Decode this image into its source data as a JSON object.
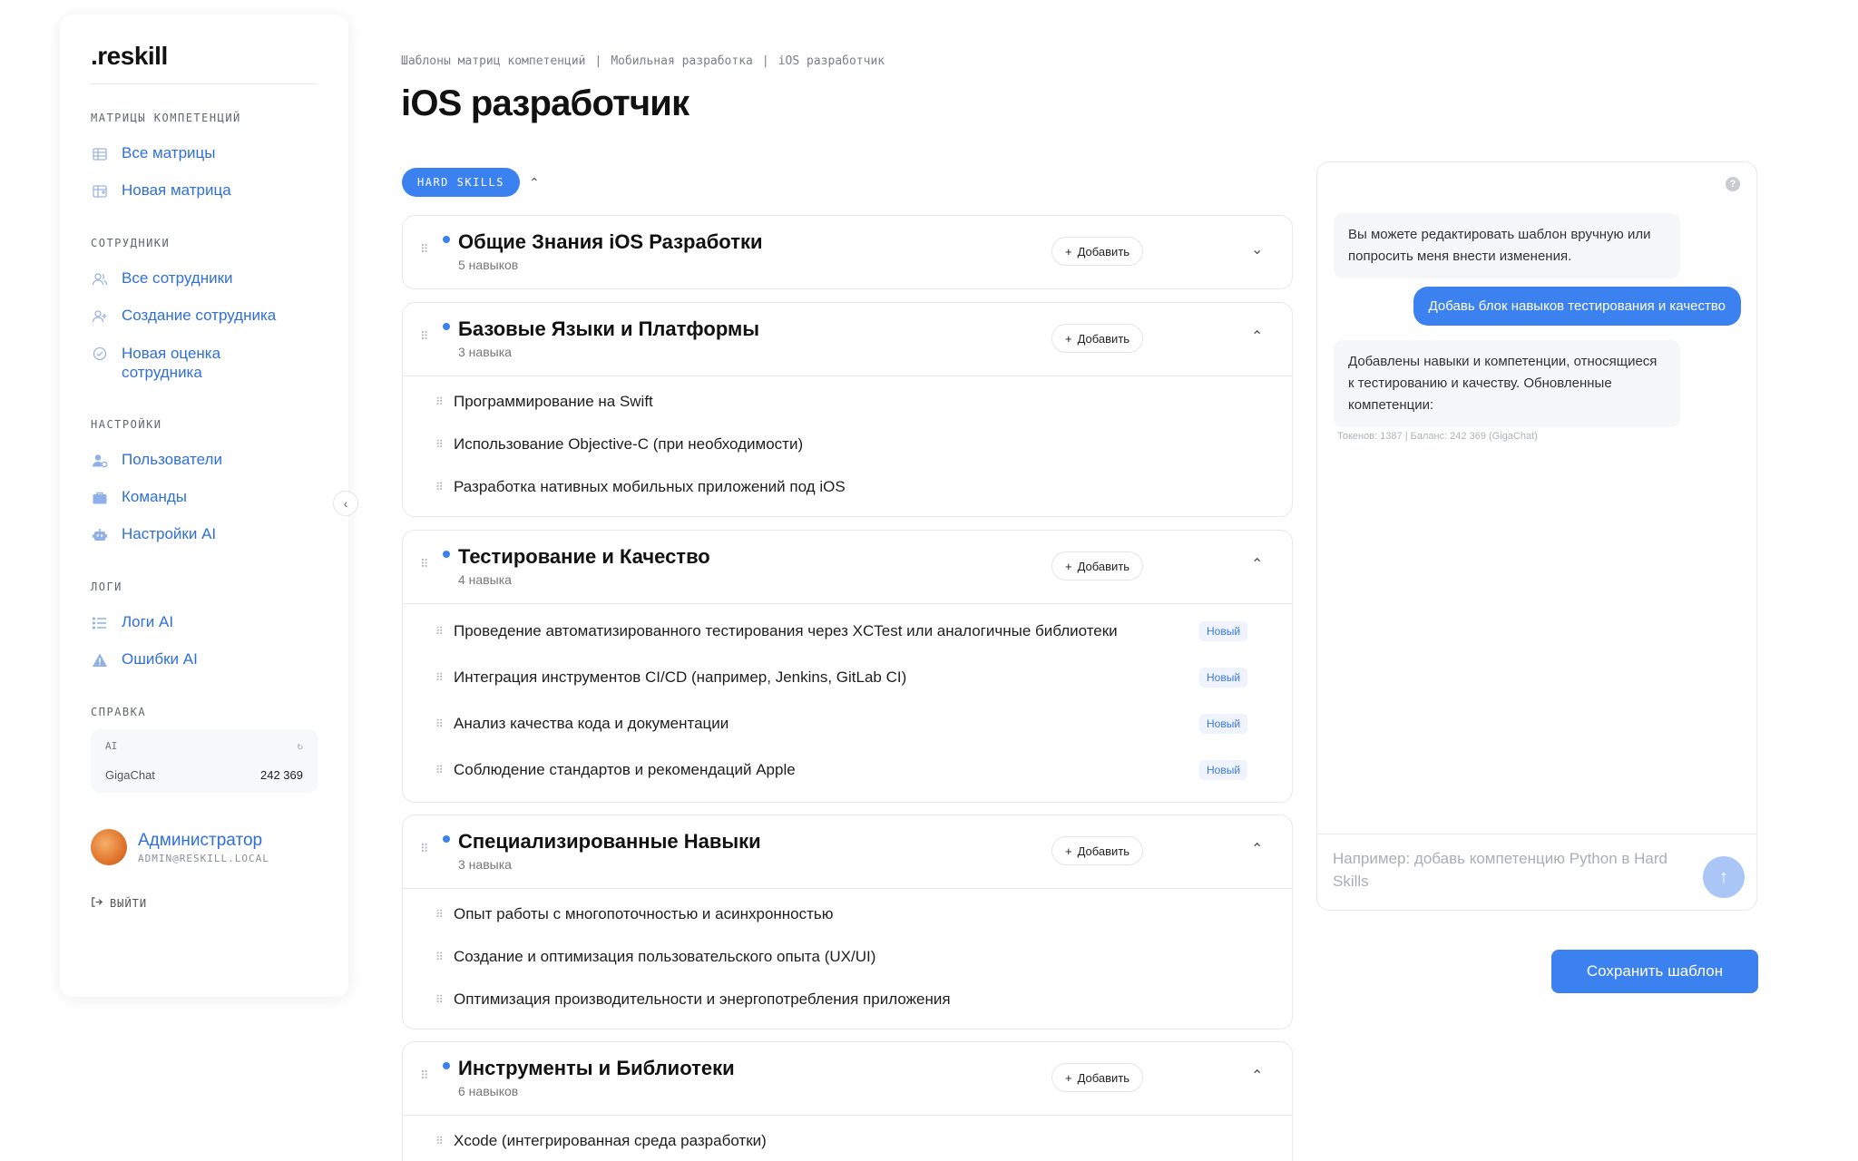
{
  "app": {
    "logo": ".reskill"
  },
  "sidebar": {
    "sections": [
      {
        "title": "МАТРИЦЫ КОМПЕТЕНЦИЙ",
        "items": [
          {
            "label": "Все матрицы",
            "icon": "table-icon"
          },
          {
            "label": "Новая матрица",
            "icon": "table-plus-icon"
          }
        ]
      },
      {
        "title": "СОТРУДНИКИ",
        "items": [
          {
            "label": "Все сотрудники",
            "icon": "users-icon"
          },
          {
            "label": "Создание сотрудника",
            "icon": "user-plus-icon"
          },
          {
            "label": "Новая оценка сотрудника",
            "icon": "badge-check-icon"
          }
        ]
      },
      {
        "title": "НАСТРОЙКИ",
        "items": [
          {
            "label": "Пользователи",
            "icon": "user-gear-icon"
          },
          {
            "label": "Команды",
            "icon": "briefcase-icon"
          },
          {
            "label": "Настройки AI",
            "icon": "robot-icon"
          }
        ]
      },
      {
        "title": "ЛОГИ",
        "items": [
          {
            "label": "Логи AI",
            "icon": "list-icon"
          },
          {
            "label": "Ошибки AI",
            "icon": "warning-icon"
          }
        ]
      }
    ],
    "help": {
      "title": "СПРАВКА",
      "ai_label": "AI",
      "provider": "GigaChat",
      "balance": "242 369"
    },
    "user": {
      "name": "Администратор",
      "email": "ADMIN@RESKILL.LOCAL"
    },
    "logout": "ВЫЙТИ"
  },
  "breadcrumb": [
    "Шаблоны матриц компетенций",
    "|",
    "Мобильная разработка",
    "|",
    "iOS разработчик"
  ],
  "page_title": "iOS разработчик",
  "chip": "HARD SKILLS",
  "add_label": "Добавить",
  "new_badge": "Новый",
  "groups": [
    {
      "title": "Общие Знания iOS Разработки",
      "count": "5 навыков",
      "expanded": false,
      "skills": []
    },
    {
      "title": "Базовые Языки и Платформы",
      "count": "3 навыка",
      "expanded": true,
      "skills": [
        {
          "name": "Программирование на Swift",
          "new": false
        },
        {
          "name": "Использование Objective-C (при необходимости)",
          "new": false
        },
        {
          "name": "Разработка нативных мобильных приложений под iOS",
          "new": false
        }
      ]
    },
    {
      "title": "Тестирование и Качество",
      "count": "4 навыка",
      "expanded": true,
      "skills": [
        {
          "name": "Проведение автоматизированного тестирования через XCTest или аналогичные библиотеки",
          "new": true
        },
        {
          "name": "Интеграция инструментов CI/CD (например, Jenkins, GitLab CI)",
          "new": true
        },
        {
          "name": "Анализ качества кода и документации",
          "new": true
        },
        {
          "name": "Соблюдение стандартов и рекомендаций Apple",
          "new": true
        }
      ]
    },
    {
      "title": "Специализированные Навыки",
      "count": "3 навыка",
      "expanded": true,
      "skills": [
        {
          "name": "Опыт работы с многопоточностью и асинхронностью",
          "new": false
        },
        {
          "name": "Создание и оптимизация пользовательского опыта (UX/UI)",
          "new": false
        },
        {
          "name": "Оптимизация производительности и энергопотребления приложения",
          "new": false
        }
      ]
    },
    {
      "title": "Инструменты и Библиотеки",
      "count": "6 навыков",
      "expanded": true,
      "skills": [
        {
          "name": "Xcode (интегрированная среда разработки)",
          "new": false
        }
      ]
    }
  ],
  "chat": {
    "messages": [
      {
        "role": "bot",
        "text": "Вы можете редактировать шаблон вручную или попросить меня внести изменения."
      },
      {
        "role": "user",
        "text": "Добавь блок навыков тестирования и качество"
      },
      {
        "role": "bot",
        "text": "Добавлены навыки и компетенции, относящиеся к тестированию и качеству. Обновленные компетенции:"
      }
    ],
    "tokens": "Токенов: 1387 | Баланс: 242 369 (GigaChat)",
    "input_placeholder": "Например: добавь компетенцию Python в Hard Skills"
  },
  "save_button": "Сохранить шаблон",
  "colors": {
    "accent": "#3b82f0",
    "link": "#2f6fdc",
    "badge_bg": "#eef3fd"
  }
}
